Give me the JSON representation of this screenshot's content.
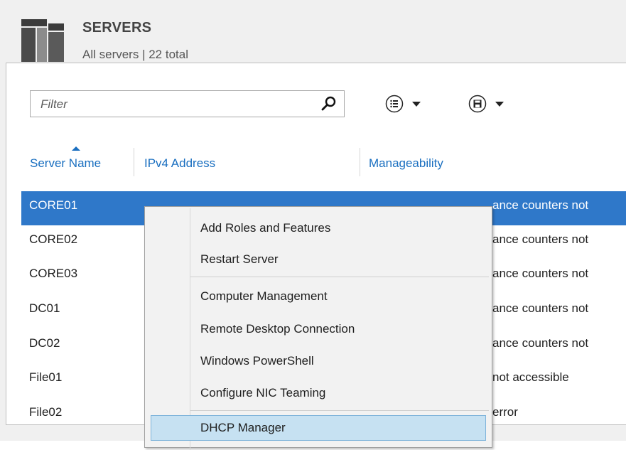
{
  "header": {
    "title": "SERVERS",
    "subtitle": "All servers | 22 total"
  },
  "toolbar": {
    "filter_placeholder": "Filter",
    "search_icon": "search-icon",
    "view_options_icon": "list-options-icon",
    "save_query_icon": "save-icon"
  },
  "columns": {
    "server_name": "Server Name",
    "ipv4": "IPv4 Address",
    "manageability": "Manageability",
    "sort_indicator": "sort-ascending-icon"
  },
  "rows": [
    {
      "name": "CORE01",
      "manageability": "ance counters not",
      "selected": true
    },
    {
      "name": "CORE02",
      "manageability": "ance counters not"
    },
    {
      "name": "CORE03",
      "manageability": "ance counters not"
    },
    {
      "name": "DC01",
      "manageability": "ance counters not"
    },
    {
      "name": "DC02",
      "manageability": "ance counters not"
    },
    {
      "name": "File01",
      "manageability": " not accessible"
    },
    {
      "name": "File02",
      "manageability": " error"
    }
  ],
  "context_menu": {
    "items": [
      "Add Roles and Features",
      "Restart Server",
      "Computer Management",
      "Remote Desktop Connection",
      "Windows PowerShell",
      "Configure NIC Teaming",
      "DHCP Manager"
    ],
    "highlighted": "DHCP Manager"
  },
  "colors": {
    "selection": "#2f78c9",
    "link_blue": "#1a6fc0",
    "menu_hover": "#c6e1f2"
  }
}
